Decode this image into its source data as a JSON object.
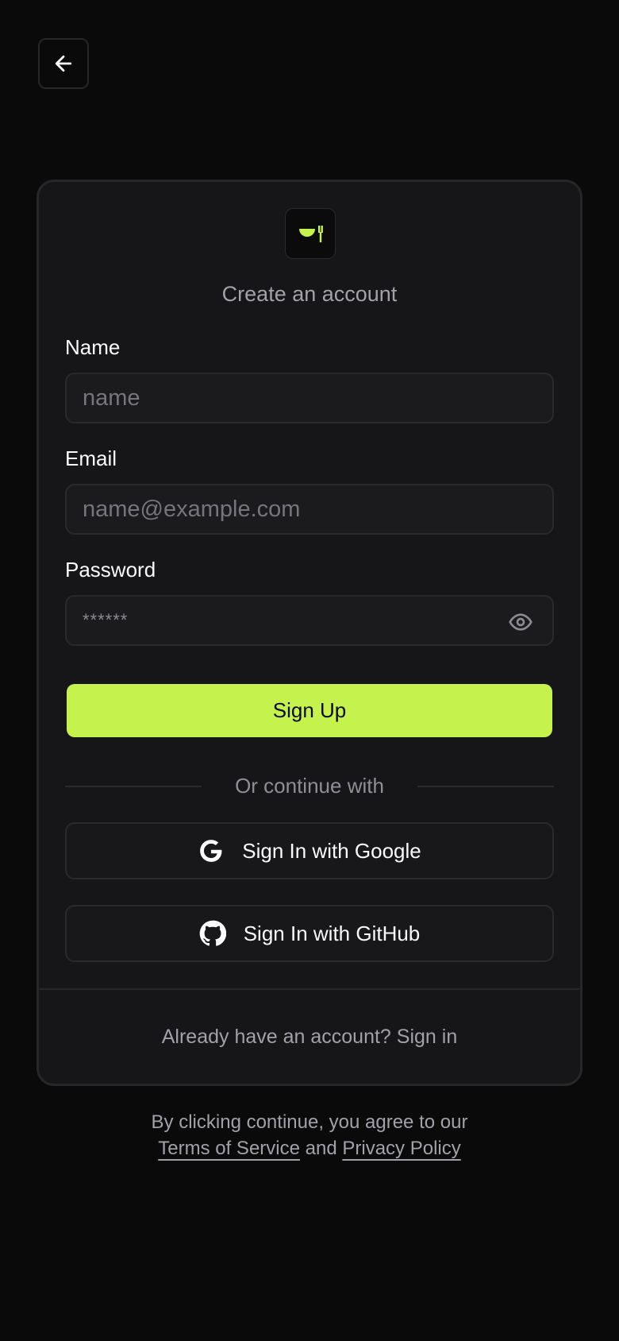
{
  "nav": {
    "back_icon": "arrow-left-icon"
  },
  "brand": {
    "logo_icon": "bowl-fork-icon",
    "accent_color": "#c6f24e"
  },
  "form": {
    "subtitle": "Create an account",
    "name": {
      "label": "Name",
      "placeholder": "name"
    },
    "email": {
      "label": "Email",
      "placeholder": "name@example.com"
    },
    "password": {
      "label": "Password",
      "placeholder": "******",
      "toggle_icon": "eye-icon"
    },
    "submit_label": "Sign Up",
    "divider_text": "Or continue with"
  },
  "oauth": {
    "google_label": "Sign In with Google",
    "google_icon": "google-icon",
    "github_label": "Sign In with GitHub",
    "github_icon": "github-icon"
  },
  "footer": {
    "prompt": "Already have an account?",
    "link": "Sign in"
  },
  "legal": {
    "prefix": "By clicking continue, you agree to our",
    "terms": "Terms of Service",
    "and": "and",
    "privacy": "Privacy Policy"
  }
}
